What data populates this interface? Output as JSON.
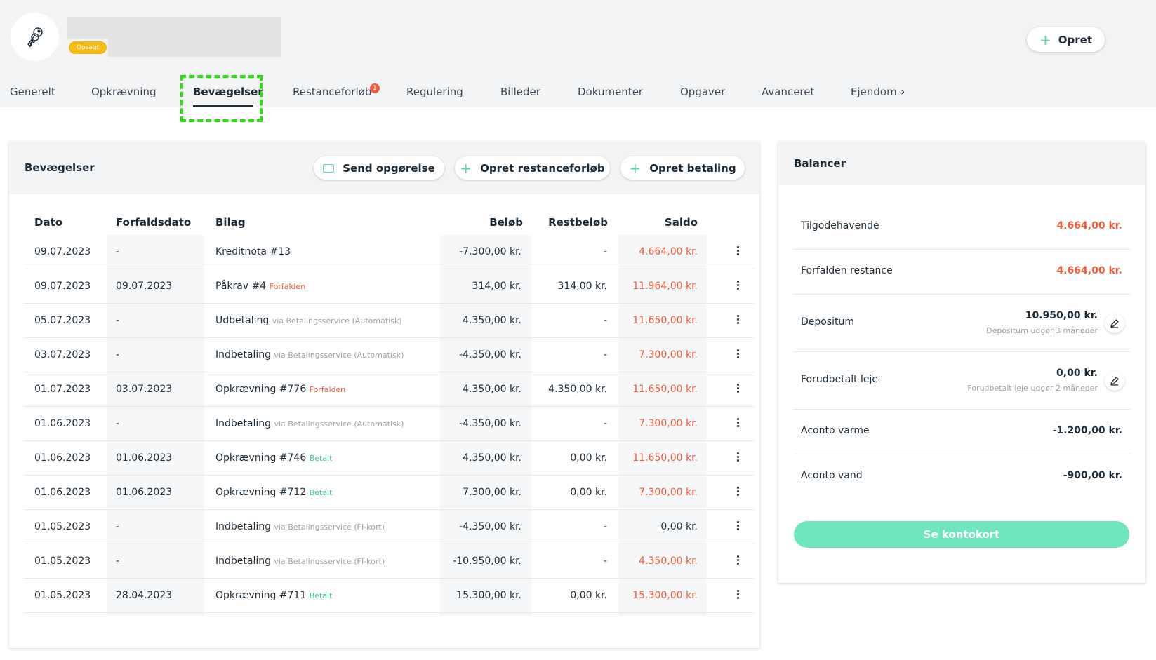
{
  "header": {
    "status_badge": "Opsagt",
    "opret_label": "Opret"
  },
  "tabs": [
    {
      "label": "Generelt"
    },
    {
      "label": "Opkrævning"
    },
    {
      "label": "Bevægelser"
    },
    {
      "label": "Restanceforløb"
    },
    {
      "label": "Regulering"
    },
    {
      "label": "Billeder"
    },
    {
      "label": "Dokumenter"
    },
    {
      "label": "Opgaver"
    },
    {
      "label": "Avanceret"
    },
    {
      "label": "Ejendom"
    }
  ],
  "restance_badge": "1",
  "movements": {
    "title": "Bevægelser",
    "buttons": {
      "send": "Send opgørelse",
      "restance": "Opret restanceforløb",
      "betaling": "Opret betaling"
    },
    "columns": {
      "dato": "Dato",
      "forfaldsdato": "Forfaldsdato",
      "bilag": "Bilag",
      "beloeb": "Beløb",
      "restbeloeb": "Restbeløb",
      "saldo": "Saldo"
    },
    "rows": [
      {
        "dato": "09.07.2023",
        "forfald": "-",
        "bilag": "Kreditnota #13",
        "note": "",
        "belob": "-7.300,00 kr.",
        "rest": "-",
        "saldo": "4.664,00 kr."
      },
      {
        "dato": "09.07.2023",
        "forfald": "09.07.2023",
        "bilag": "Påkrav #4",
        "note": "Forfalden",
        "belob": "314,00 kr.",
        "rest": "314,00 kr.",
        "saldo": "11.964,00 kr."
      },
      {
        "dato": "05.07.2023",
        "forfald": "-",
        "bilag": "Udbetaling",
        "note": "via Betalingsservice (Automatisk)",
        "belob": "4.350,00 kr.",
        "rest": "-",
        "saldo": "11.650,00 kr."
      },
      {
        "dato": "03.07.2023",
        "forfald": "-",
        "bilag": "Indbetaling",
        "note": "via Betalingsservice (Automatisk)",
        "belob": "-4.350,00 kr.",
        "rest": "-",
        "saldo": "7.300,00 kr."
      },
      {
        "dato": "01.07.2023",
        "forfald": "03.07.2023",
        "bilag": "Opkrævning #776",
        "note": "Forfalden",
        "belob": "4.350,00 kr.",
        "rest": "4.350,00 kr.",
        "saldo": "11.650,00 kr."
      },
      {
        "dato": "01.06.2023",
        "forfald": "-",
        "bilag": "Indbetaling",
        "note": "via Betalingsservice (Automatisk)",
        "belob": "-4.350,00 kr.",
        "rest": "-",
        "saldo": "7.300,00 kr."
      },
      {
        "dato": "01.06.2023",
        "forfald": "01.06.2023",
        "bilag": "Opkrævning #746",
        "note": "Betalt",
        "belob": "4.350,00 kr.",
        "rest": "0,00 kr.",
        "saldo": "11.650,00 kr."
      },
      {
        "dato": "01.06.2023",
        "forfald": "01.06.2023",
        "bilag": "Opkrævning #712",
        "note": "Betalt",
        "belob": "7.300,00 kr.",
        "rest": "0,00 kr.",
        "saldo": "7.300,00 kr."
      },
      {
        "dato": "01.05.2023",
        "forfald": "-",
        "bilag": "Indbetaling",
        "note": "via Betalingsservice (FI-kort)",
        "belob": "-4.350,00 kr.",
        "rest": "-",
        "saldo": "0,00 kr."
      },
      {
        "dato": "01.05.2023",
        "forfald": "-",
        "bilag": "Indbetaling",
        "note": "via Betalingsservice (FI-kort)",
        "belob": "-10.950,00 kr.",
        "rest": "-",
        "saldo": "4.350,00 kr."
      },
      {
        "dato": "01.05.2023",
        "forfald": "28.04.2023",
        "bilag": "Opkrævning #711",
        "note": "Betalt",
        "belob": "15.300,00 kr.",
        "rest": "0,00 kr.",
        "saldo": "15.300,00 kr."
      }
    ]
  },
  "balances": {
    "title": "Balancer",
    "items": [
      {
        "label": "Tilgodehavende",
        "value": "4.664,00 kr."
      },
      {
        "label": "Forfalden restance",
        "value": "4.664,00 kr."
      },
      {
        "label": "Depositum",
        "value": "10.950,00 kr.",
        "sub": "Depositum udgør 3 måneder"
      },
      {
        "label": "Forudbetalt leje",
        "value": "0,00 kr.",
        "sub": "Forudbetalt leje udgør 2 måneder"
      },
      {
        "label": "Aconto varme",
        "value": "-1.200,00 kr."
      },
      {
        "label": "Aconto vand",
        "value": "-900,00 kr."
      }
    ],
    "button": "Se kontokort"
  }
}
